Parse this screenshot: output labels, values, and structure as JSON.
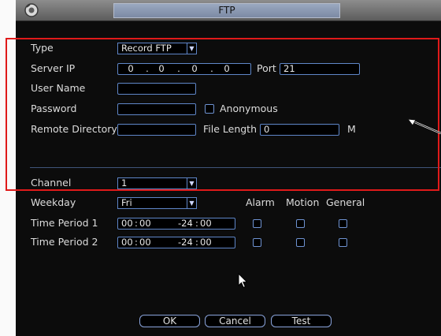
{
  "window": {
    "title": "FTP"
  },
  "labels": {
    "type": "Type",
    "server_ip": "Server IP",
    "port": "Port",
    "user_name": "User Name",
    "password": "Password",
    "anonymous": "Anonymous",
    "remote_directory": "Remote Directory",
    "file_length": "File Length",
    "file_length_unit": "M",
    "channel": "Channel",
    "weekday": "Weekday",
    "alarm": "Alarm",
    "motion": "Motion",
    "general": "General",
    "time_period_1": "Time Period 1",
    "time_period_2": "Time Period 2"
  },
  "fields": {
    "type_value": "Record FTP",
    "ip": [
      "0",
      "0",
      "0",
      "0"
    ],
    "ip_separator": ".",
    "port_value": "21",
    "user_name_value": "",
    "password_value": "",
    "anonymous_checked": false,
    "remote_directory_value": "",
    "file_length_value": "0",
    "channel_value": "1",
    "weekday_value": "Fri"
  },
  "time_periods": [
    {
      "start_h": "00",
      "start_m": "00",
      "end_h": "-24",
      "end_m": "00",
      "alarm": false,
      "motion": false,
      "general": false
    },
    {
      "start_h": "00",
      "start_m": "00",
      "end_h": "-24",
      "end_m": "00",
      "alarm": false,
      "motion": false,
      "general": false
    }
  ],
  "time_separator": ":",
  "buttons": {
    "ok": "OK",
    "cancel": "Cancel",
    "test": "Test"
  },
  "icons": {
    "logo": "dvr-logo-icon",
    "dropdown": "chevron-down-icon",
    "pointer": "mouse-pointer-icon"
  },
  "colors": {
    "highlight_box": "#e01a1a",
    "field_border": "#5f86c8",
    "background": "#0c0c0c"
  }
}
